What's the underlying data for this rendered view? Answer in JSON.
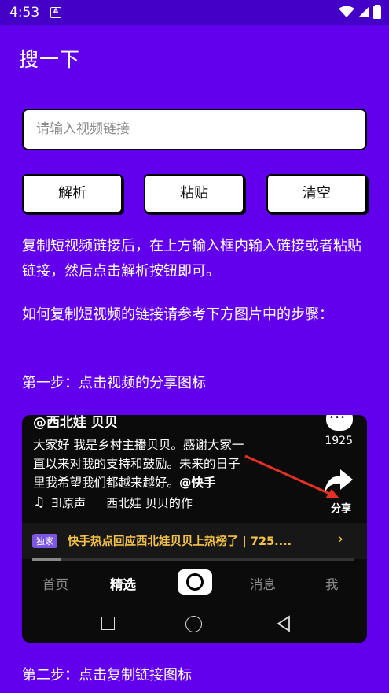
{
  "status_bar": {
    "time": "4:53",
    "notification_letter": "A"
  },
  "app": {
    "title": "搜一下"
  },
  "search": {
    "placeholder": "请输入视频链接",
    "value": ""
  },
  "buttons": {
    "parse": "解析",
    "paste": "粘贴",
    "clear": "清空"
  },
  "instructions": {
    "p1": "复制短视频链接后，在上方输入框内输入链接或者粘贴链接，然后点击解析按钮即可。",
    "p2": "如何复制短视频的链接请参考下方图片中的步骤：",
    "step1": "第一步：点击视频的分享图标",
    "step2": "第二步：点击复制链接图标"
  },
  "example_card": {
    "author": "@西北娃 贝贝",
    "text_lines": [
      "大家好 我是乡村主播贝贝。感谢大家一",
      "直以来对我的支持和鼓励。未来的日子",
      "里我希望我们都越来越好。"
    ],
    "mention": "@快手",
    "music_label": "♫",
    "music_original": "ƎI原声",
    "music_author": "西北娃 贝贝的作",
    "comment_count": "1925",
    "share_label": "分享",
    "banner_badge": "独家",
    "banner_text": "快手热点回应西北娃贝贝上热榜了 | 725....",
    "banner_chevron": "›",
    "video_progress": 0.09,
    "tabs": {
      "home": "首页",
      "featured": "精选",
      "messages": "消息",
      "me": "我"
    }
  },
  "colors": {
    "background": "#6200EE",
    "status_bar": "#4500C8",
    "banner_text": "#F6C34A",
    "arrow": "#E53026"
  }
}
